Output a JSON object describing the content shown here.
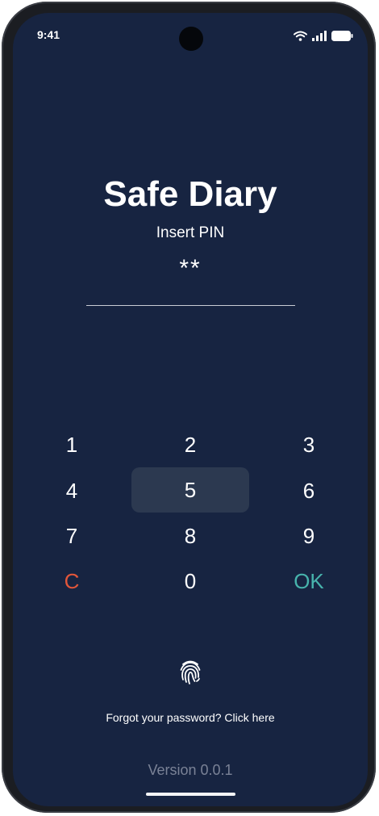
{
  "status_bar": {
    "time": "9:41",
    "icons": [
      "wifi-icon",
      "signal-icon",
      "battery-icon"
    ]
  },
  "header": {
    "title": "Safe Diary",
    "subtitle": "Insert PIN"
  },
  "pin": {
    "masked_value": "**"
  },
  "keypad": {
    "keys": [
      "1",
      "2",
      "3",
      "4",
      "5",
      "6",
      "7",
      "8",
      "9",
      "C",
      "0",
      "OK"
    ],
    "highlighted_key": "5"
  },
  "fingerprint": {
    "icon": "fingerprint-icon"
  },
  "footer": {
    "forgot_link": "Forgot your password? Click here",
    "version": "Version 0.0.1"
  },
  "colors": {
    "background": "#172441",
    "clear_key": "#e2563a",
    "ok_key": "#47b3ac",
    "highlight": "#2c3950",
    "version_text": "#7a8296"
  }
}
